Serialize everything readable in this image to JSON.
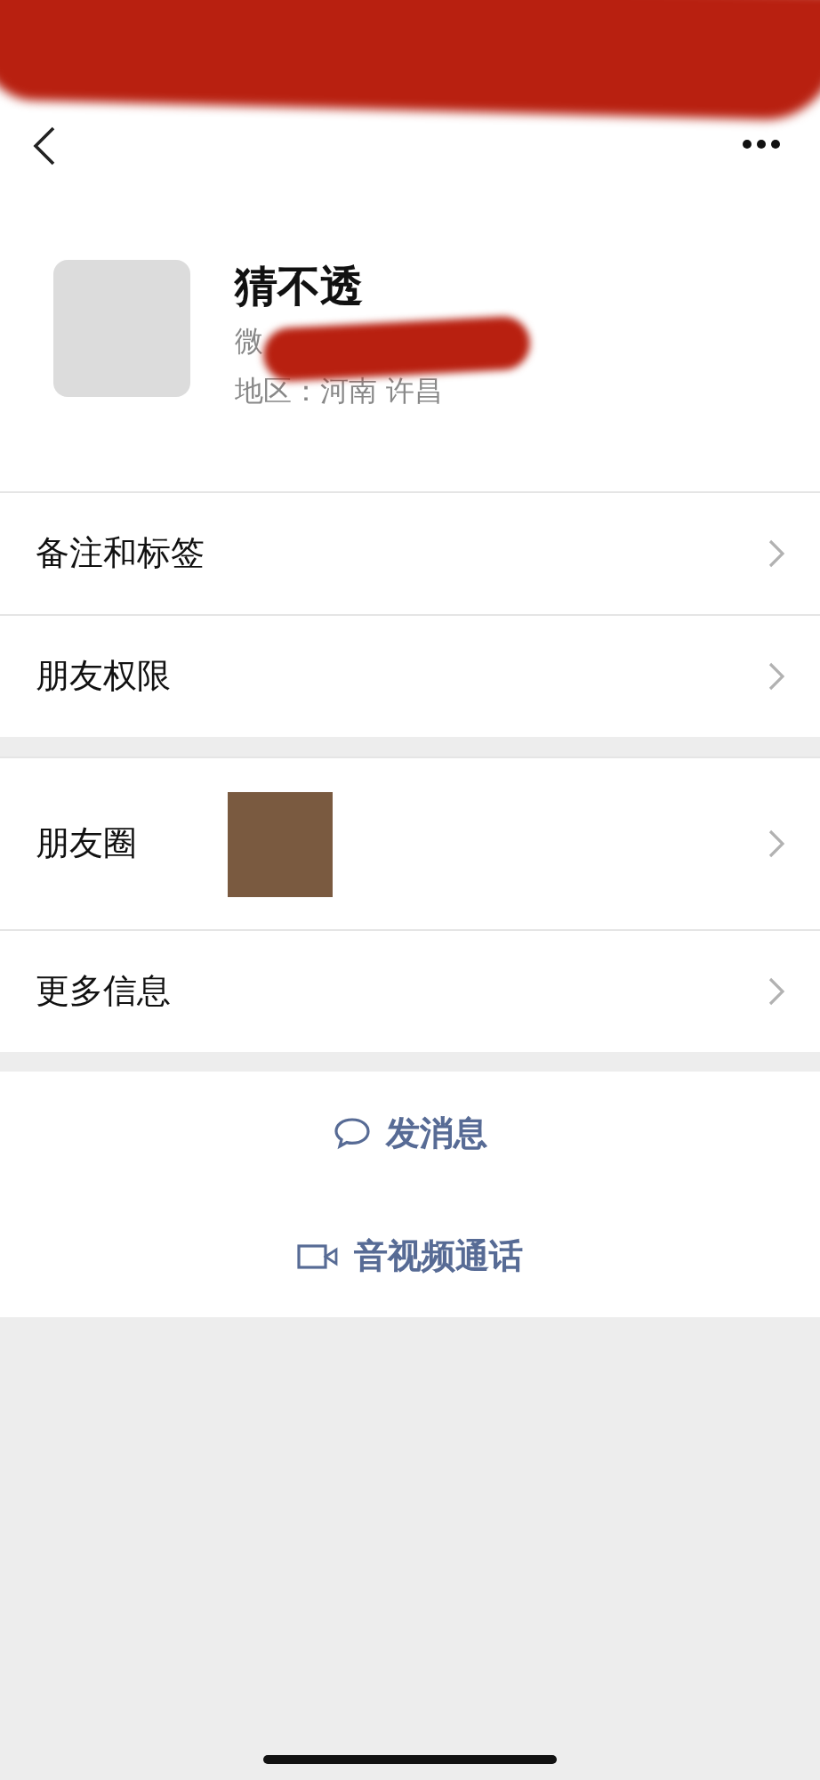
{
  "profile": {
    "name": "猜不透",
    "wechat_id": "微",
    "region": "地区：河南 许昌"
  },
  "sections": [
    {
      "rows": [
        {
          "kind": "plain",
          "label": "备注和标签"
        },
        {
          "kind": "plain",
          "label": "朋友权限"
        }
      ]
    },
    {
      "rows": [
        {
          "kind": "moments",
          "label": "朋友圈"
        },
        {
          "kind": "plain",
          "label": "更多信息"
        }
      ]
    }
  ],
  "actions": [
    {
      "kind": "chat",
      "label": "发消息"
    },
    {
      "kind": "video",
      "label": "音视频通话"
    }
  ]
}
